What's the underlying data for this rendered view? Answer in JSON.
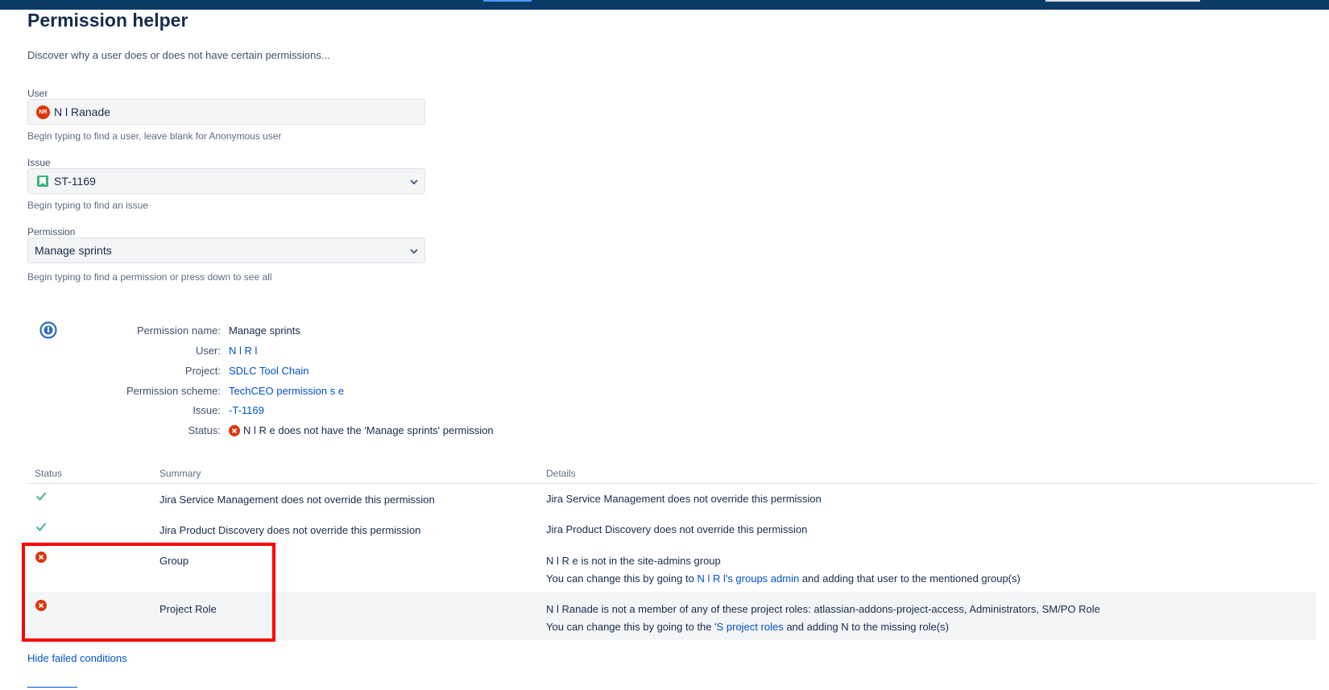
{
  "header": {
    "title": "Permission helper",
    "subtitle": "Discover why a user does or does not have certain permissions..."
  },
  "form": {
    "user": {
      "label": "User",
      "avatar_initials": "NR",
      "value": "N     l Ranade",
      "help": "Begin typing to find a user, leave blank for Anonymous user"
    },
    "issue": {
      "label": "Issue",
      "value": "ST-1169",
      "help": "Begin typing to find an issue"
    },
    "permission": {
      "label": "Permission",
      "value": "Manage sprints",
      "help": "Begin typing to find a permission or press down to see all"
    }
  },
  "details": {
    "permission_name_label": "Permission name:",
    "permission_name_value": "Manage sprints",
    "user_label": "User:",
    "user_value": "N     l R    l",
    "project_label": "Project:",
    "project_value": "SDLC Tool Chain",
    "scheme_label": "Permission scheme:",
    "scheme_value": "TechCEO permission s      e",
    "issue_label": "Issue:",
    "issue_value": "-T-1169",
    "status_label": "Status:",
    "status_value": "N     l R    e does not have the 'Manage sprints' permission"
  },
  "table": {
    "headers": {
      "status": "Status",
      "summary": "Summary",
      "details": "Details"
    },
    "rows": [
      {
        "status": "pass",
        "summary": "Jira Service Management does not override this permission",
        "details_line1": "Jira Service Management does not override this permission"
      },
      {
        "status": "pass",
        "summary": "Jira Product Discovery does not override this permission",
        "details_line1": "Jira Product Discovery does not override this permission"
      },
      {
        "status": "fail",
        "summary": "Group",
        "details_line1": "N     l R    e is not in the site-admins group",
        "details_line2_pre": "You can change this by going to ",
        "details_line2_link": "N     l R    l's groups admin",
        "details_line2_post": " and adding that user to the mentioned group(s)"
      },
      {
        "status": "fail",
        "summary": "Project Role",
        "details_line1": "N     l Ranade is not a member of any of these project roles: atlassian-addons-project-access, Administrators, SM/PO Role",
        "details_line2_pre": "You can change this by going to the ",
        "details_line2_link": "'S              project roles",
        "details_line2_post_pre": " and adding N           ",
        "details_line2_post": " to the missing role(s)"
      }
    ]
  },
  "footer": {
    "hide_failed": "Hide failed conditions"
  },
  "colors": {
    "link": "#0052cc",
    "success": "#36b37e",
    "error": "#de350b",
    "highlight": "#ff0000",
    "topbar": "#0a3a66"
  }
}
